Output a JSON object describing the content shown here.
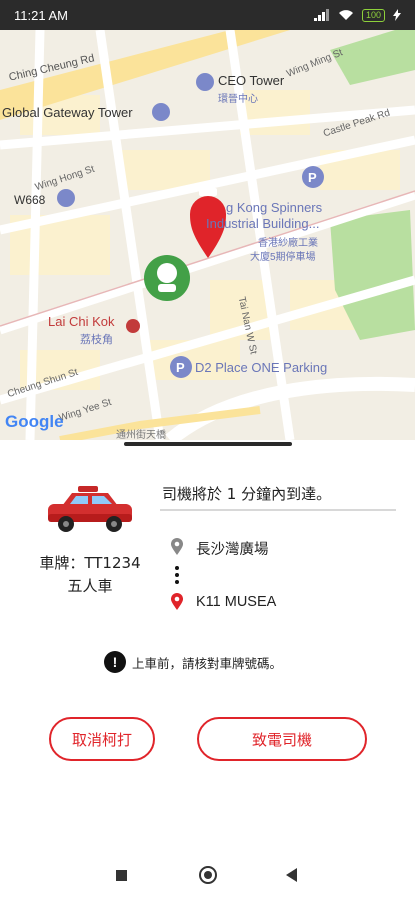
{
  "status_bar": {
    "time": "11:21 AM",
    "battery": "100"
  },
  "map": {
    "labels": {
      "ching_cheung_rd": "Ching Cheung Rd",
      "wing_ming_st": "Wing Ming St",
      "ceo_tower": "CEO Tower",
      "ceo_tower_zh": "環晉中心",
      "global_gateway": "Global Gateway Tower",
      "castle_peak_rd": "Castle Peak Rd",
      "wing_hong_st": "Wing Hong St",
      "w668": "W668",
      "spinners": "g Kong Spinners",
      "spinners2": "Industrial Building...",
      "spinners_zh1": "香港紗廠工業",
      "spinners_zh2": "大廈5期停車場",
      "lai_chi_kok": "Lai Chi Kok",
      "lai_chi_kok_zh": "荔枝角",
      "tai_nan_w_st": "Tai Nan W St",
      "cheung_shun_st": "Cheung Shun St",
      "d2_place": "D2 Place ONE Parking",
      "wing_yee_st": "Wing Yee St",
      "google": "Google",
      "bottom_zh": "通州街天橋"
    }
  },
  "trip": {
    "eta_text": "司機將於 1 分鐘內到達。",
    "plate": "車牌：TT1234",
    "vehicle_type": "五人車",
    "pickup": "長沙灣廣場",
    "dropoff": "K11 MUSEA",
    "notice": "上車前，請核對車牌號碼。"
  },
  "actions": {
    "cancel_label": "取消柯打",
    "call_label": "致電司機"
  },
  "colors": {
    "accent_red": "#e0242a",
    "user_green": "#43a047",
    "park_green": "#b8dfa0",
    "poi_blue": "#7b88c9"
  }
}
